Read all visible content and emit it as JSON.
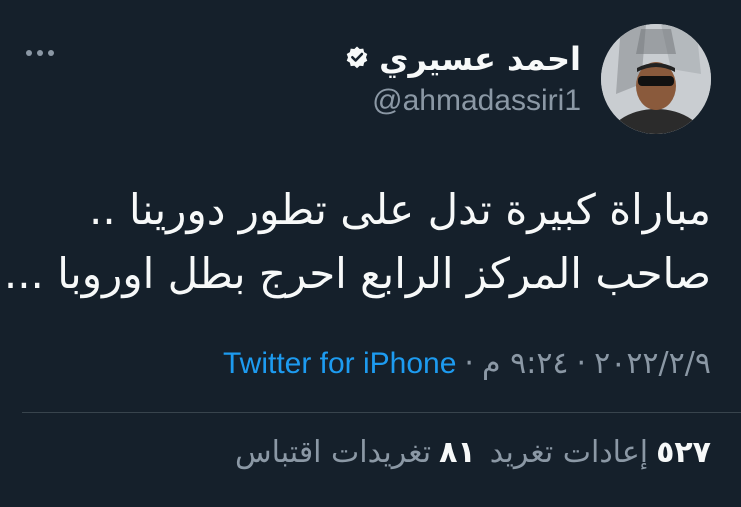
{
  "author": {
    "display_name": "احمد عسيري",
    "handle": "@ahmadassiri1",
    "verified_icon": "verified-badge-icon",
    "accent_color": "#f7f9f9"
  },
  "tweet": {
    "lines": [
      "مباراة كبيرة تدل على تطور دورينا ..",
      "صاحب المركز الرابع احرج بطل اوروبا ..."
    ]
  },
  "meta": {
    "date": "٢٠٢٢/٢/٩",
    "separator": "·",
    "time": "٩:٢٤ م",
    "source": "Twitter for iPhone",
    "source_color": "#1d9bf0"
  },
  "stats": {
    "retweets_count": "٥٢٧",
    "retweets_label": "إعادات تغريد",
    "quotes_count": "٨١",
    "quotes_label": "تغريدات اقتباس"
  },
  "menu": {
    "icon": "more-options-icon"
  }
}
